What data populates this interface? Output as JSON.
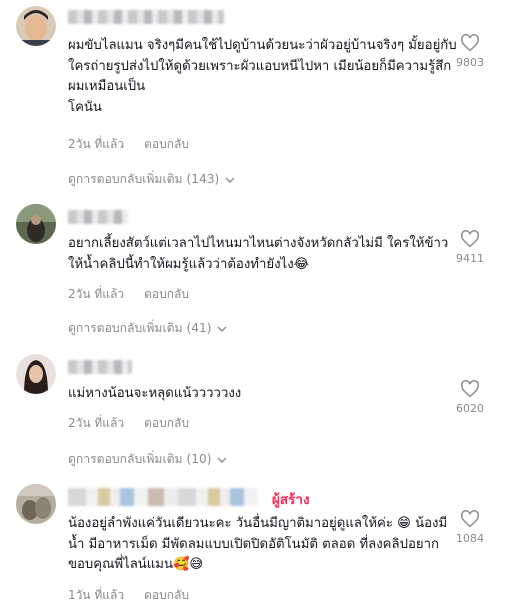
{
  "comments": [
    {
      "text": "ผมขับไลแมน จริงๆมีคนใช้ไปดูบ้านด้วยนะว่าผัวอยู่บ้านจริงๆ มั้ยอยู่กับใครถ่ายรูปส่งไปให้ดูด้วยเพราะผัวแอบหนีไปหา เมียน้อยก็มีความรู้สึกผมเหมือนเป็น\nโคนัน",
      "time": "2วัน ที่แล้ว",
      "reply": "ตอบกลับ",
      "likes": "9803",
      "view_replies": "ดูการตอบกลับเพิ่มเติม (143)"
    },
    {
      "text": "อยากเลี้ยงสัตว์แต่เวลาไปไหนมาไหนต่างจังหวัดกลัวไม่มี ใครให้ข้าวให้น้ำคลิปนี้ทำให้ผมรู้แล้วว่าต้องทำยังไง😂",
      "time": "2วัน ที่แล้ว",
      "reply": "ตอบกลับ",
      "likes": "9411",
      "view_replies": "ดูการตอบกลับเพิ่มเติม (41)"
    },
    {
      "text": "แม่หางน้อนจะหลุดแน้วววววงง",
      "time": "2วัน ที่แล้ว",
      "reply": "ตอบกลับ",
      "likes": "6020",
      "view_replies": "ดูการตอบกลับเพิ่มเติม (10)"
    },
    {
      "creator_label": "ผู้สร้าง",
      "text": "น้องอยู่ลำพังแค่วันเดียวนะคะ วันอื่นมีญาติมาอยู่ดูแลให้ค่ะ 😁 น้องมีน้ำ มีอาหารเม็ด มีพัดลมแบบเปิดปิดอัติโนมัติ ตลอด ที่ลงคลิปอยากขอบคุณพี่ไลน์แมน🥰😅",
      "time": "1วัน ที่แล้ว",
      "reply": "ตอบกลับ",
      "likes": "1084"
    }
  ],
  "icons": {
    "like": "heart-outline-icon",
    "expand": "chevron-down-icon"
  },
  "colors": {
    "creator": "#fe2c55",
    "meta": "#8a8b91",
    "text": "#161823"
  }
}
